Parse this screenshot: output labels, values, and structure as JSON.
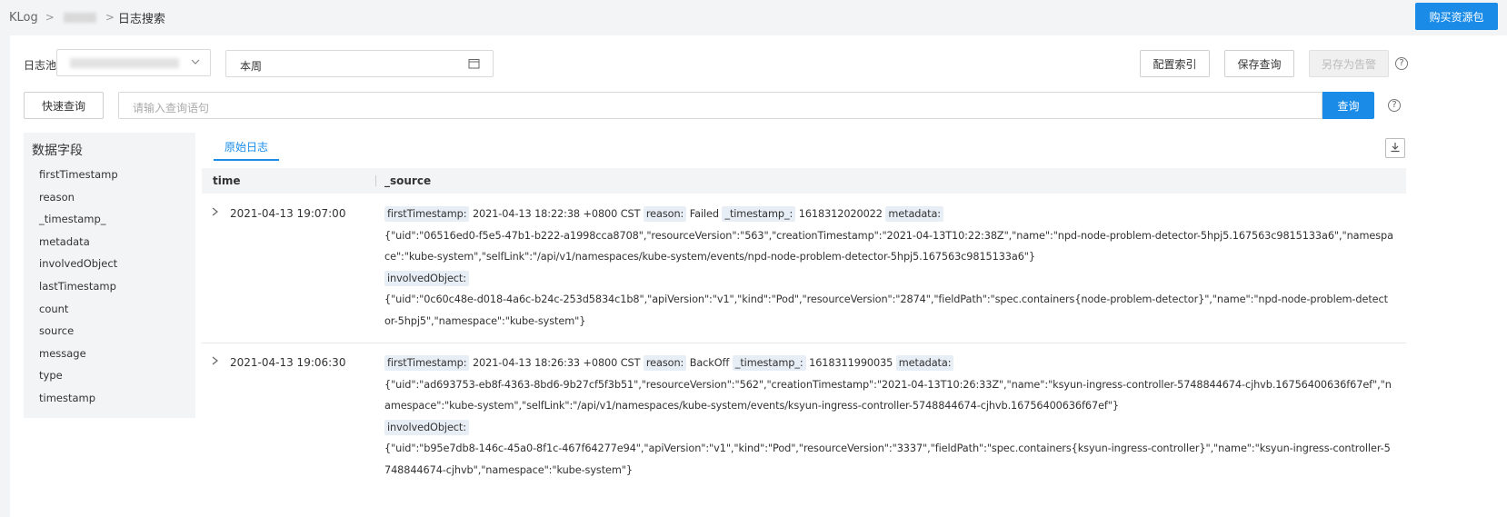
{
  "breadcrumb": {
    "root": "KLog",
    "sep1": ">",
    "sep2": ">",
    "current": "日志搜索"
  },
  "header": {
    "buy_label": "购买资源包"
  },
  "filters": {
    "pool_label": "日志池",
    "date_value": "本周",
    "config_index_label": "配置索引",
    "save_query_label": "保存查询",
    "save_alert_label": "另存为告警",
    "help": "?"
  },
  "query": {
    "quick_label": "快速查询",
    "placeholder": "请输入查询语句",
    "search_label": "查询",
    "help": "?"
  },
  "fields": {
    "title": "数据字段",
    "items": [
      "firstTimestamp",
      "reason",
      "_timestamp_",
      "metadata",
      "involvedObject",
      "lastTimestamp",
      "count",
      "source",
      "message",
      "type",
      "timestamp"
    ]
  },
  "tabs": {
    "raw_log": "原始日志"
  },
  "table": {
    "col_time": "time",
    "col_source": "_source",
    "rows": [
      {
        "time": "2021-04-13 19:07:00",
        "k_first": "firstTimestamp:",
        "v_first": " 2021-04-13 18:22:38 +0800 CST ",
        "k_reason": "reason:",
        "v_reason": " Failed ",
        "k_ts": "_timestamp_:",
        "v_ts": " 1618312020022 ",
        "k_meta": "metadata:",
        "v_meta": "{\"uid\":\"06516ed0-f5e5-47b1-b222-a1998cca8708\",\"resourceVersion\":\"563\",\"creationTimestamp\":\"2021-04-13T10:22:38Z\",\"name\":\"npd-node-problem-detector-5hpj5.167563c9815133a6\",\"namespace\":\"kube-system\",\"selfLink\":\"/api/v1/namespaces/kube-system/events/npd-node-problem-detector-5hpj5.167563c9815133a6\"}",
        "k_inv": "involvedObject:",
        "v_inv": "{\"uid\":\"0c60c48e-d018-4a6c-b24c-253d5834c1b8\",\"apiVersion\":\"v1\",\"kind\":\"Pod\",\"resourceVersion\":\"2874\",\"fieldPath\":\"spec.containers{node-problem-detector}\",\"name\":\"npd-node-problem-detector-5hpj5\",\"namespace\":\"kube-system\"}"
      },
      {
        "time": "2021-04-13 19:06:30",
        "k_first": "firstTimestamp:",
        "v_first": " 2021-04-13 18:26:33 +0800 CST ",
        "k_reason": "reason:",
        "v_reason": " BackOff ",
        "k_ts": "_timestamp_:",
        "v_ts": " 1618311990035 ",
        "k_meta": "metadata:",
        "v_meta": "{\"uid\":\"ad693753-eb8f-4363-8bd6-9b27cf5f3b51\",\"resourceVersion\":\"562\",\"creationTimestamp\":\"2021-04-13T10:26:33Z\",\"name\":\"ksyun-ingress-controller-5748844674-cjhvb.16756400636f67ef\",\"namespace\":\"kube-system\",\"selfLink\":\"/api/v1/namespaces/kube-system/events/ksyun-ingress-controller-5748844674-cjhvb.16756400636f67ef\"}",
        "k_inv": "involvedObject:",
        "v_inv": "{\"uid\":\"b95e7db8-146c-45a0-8f1c-467f64277e94\",\"apiVersion\":\"v1\",\"kind\":\"Pod\",\"resourceVersion\":\"3337\",\"fieldPath\":\"spec.containers{ksyun-ingress-controller}\",\"name\":\"ksyun-ingress-controller-5748844674-cjhvb\",\"namespace\":\"kube-system\"}"
      }
    ]
  },
  "colors": {
    "accent": "#1a8ce8",
    "key_bg": "#e8eef5",
    "page_bg": "#f3f4f6"
  },
  "icons": {
    "chevron": "chevron-down-icon",
    "calendar": "calendar-icon",
    "download": "download-icon",
    "expand": "chevron-right-icon",
    "help": "help-circle-icon"
  }
}
